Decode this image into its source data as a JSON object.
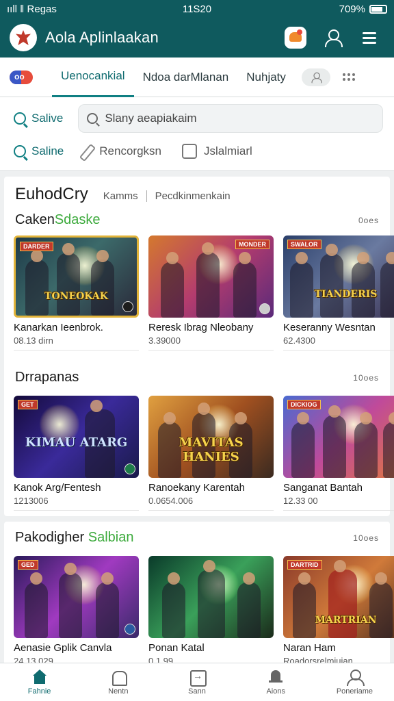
{
  "status": {
    "left": "ııll ‖ Regas",
    "time": "11S20",
    "signal": "ıl",
    "battery": "709%"
  },
  "appbar": {
    "title": "Aola Aplinlaakan",
    "logo_icon": "maple-leaf-icon"
  },
  "tabs": {
    "items": [
      "Uenocankial",
      "Ndoa darMlanan",
      "Nuhjaty"
    ],
    "active": 0
  },
  "filters": {
    "chip1": "Salive",
    "search_placeholder": "Slany aeapiakaim",
    "chip2": "Saline",
    "item2": "Rencorgksn",
    "item3": "Jslalmiarl"
  },
  "card1": {
    "title": "EuhodCry",
    "sub1": "Kamms",
    "sub2": "Pecdkinmenkain",
    "section1": {
      "title_a": "Caken",
      "title_b": "Sdaske",
      "more": "0oes",
      "tiles": [
        {
          "name": "Kanarkan Ieenbrok.",
          "price": "08.13 dirn",
          "badge": "DARDER",
          "caption": "TONEOKAK"
        },
        {
          "name": "Reresk Ibrag Nleobany",
          "price": "3.39000",
          "badge": "MONDER",
          "caption": ""
        },
        {
          "name": "Keseranny Wesntan",
          "price": "62.4300",
          "badge": "SWALOR",
          "caption": "TIANDERIS"
        }
      ]
    },
    "section2": {
      "title": "Drrapanas",
      "more": "10oes",
      "tiles": [
        {
          "name": "Kanok Arg/Fentesh",
          "price": "1213006",
          "badge": "GET",
          "caption": "KIMAU ATARG"
        },
        {
          "name": "Ranoekany Karentah",
          "price": "0.0654.006",
          "badge": "",
          "caption": "MAVITAS HANIES"
        },
        {
          "name": "Sanganat Bantah",
          "price": "12.33 00",
          "badge": "DICKIOG",
          "caption": ""
        }
      ]
    }
  },
  "card2": {
    "title_a": "Pakodigher",
    "title_b": "Salbian",
    "more": "10oes",
    "tiles": [
      {
        "name": "Aenasie Gplik Canvla",
        "price": "24.13 029",
        "badge": "GED",
        "caption": ""
      },
      {
        "name": "Ponan Katal",
        "price": "0.1.99",
        "badge": "",
        "caption": ""
      },
      {
        "name": "Naran Ham",
        "price": "Roadorsrelmiuian",
        "badge": "DARTRID",
        "caption": "MARTRIAN"
      }
    ]
  },
  "bottomnav": {
    "items": [
      "Fahnie",
      "Nentn",
      "Sann",
      "Aions",
      "Poneriame"
    ],
    "active": 0
  },
  "colors": {
    "primary": "#0f5a5e",
    "accent": "#0f7f82",
    "green": "#3caa3c"
  }
}
